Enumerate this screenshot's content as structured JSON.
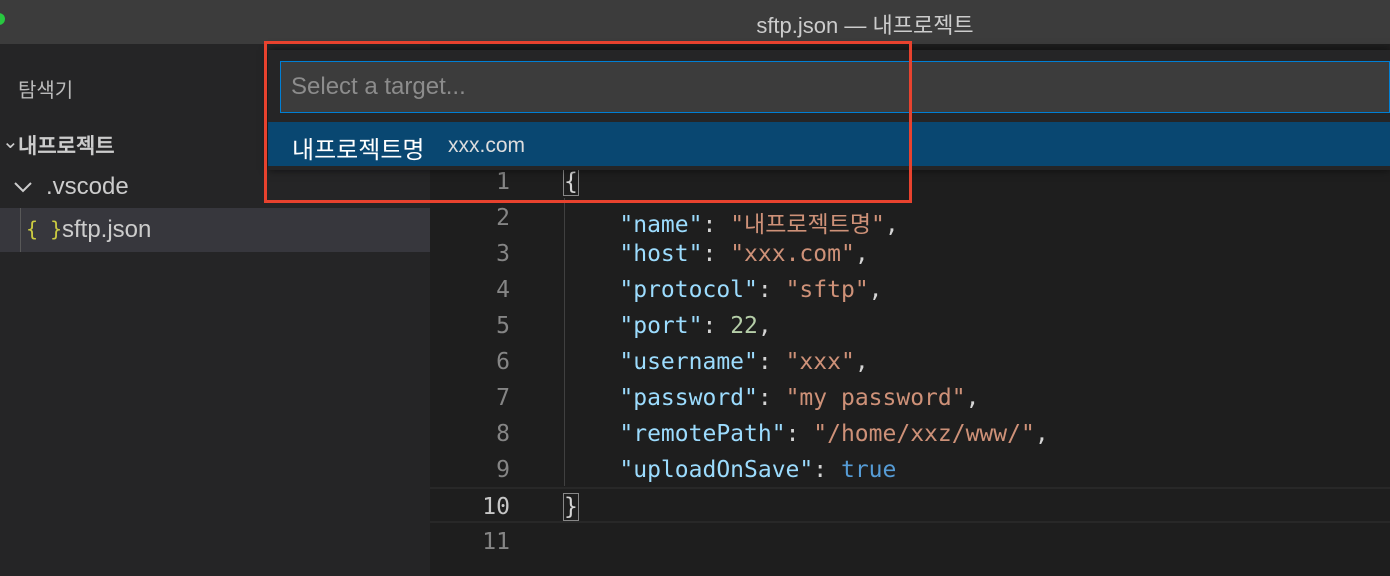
{
  "window": {
    "title": "sftp.json — 내프로젝트"
  },
  "sidebar": {
    "title": "탐색기",
    "project": "내프로젝트",
    "folder": ".vscode",
    "file": {
      "icon": "{ }",
      "name": "sftp.json"
    }
  },
  "quick_pick": {
    "placeholder": "Select a target...",
    "value": "",
    "items": [
      {
        "label": "내프로젝트명",
        "description": "xxx.com"
      }
    ]
  },
  "editor": {
    "current_line": 10,
    "lines": [
      {
        "num": "1"
      },
      {
        "num": "2",
        "key": "\"name\"",
        "value": "\"내프로젝트명\""
      },
      {
        "num": "3",
        "key": "\"host\"",
        "value": "\"xxx.com\""
      },
      {
        "num": "4",
        "key": "\"protocol\"",
        "value": "\"sftp\""
      },
      {
        "num": "5",
        "key": "\"port\"",
        "value": "22"
      },
      {
        "num": "6",
        "key": "\"username\"",
        "value": "\"xxx\""
      },
      {
        "num": "7",
        "key": "\"password\"",
        "value": "\"my password\""
      },
      {
        "num": "8",
        "key": "\"remotePath\"",
        "value": "\"/home/xxz/www/\""
      },
      {
        "num": "9",
        "key": "\"uploadOnSave\"",
        "value": "true"
      },
      {
        "num": "10"
      },
      {
        "num": "11"
      }
    ],
    "open_brace": "{",
    "close_brace": "}"
  },
  "colors": {
    "annotation_box": "#e8422e",
    "selection": "#094771",
    "json_key": "#9cdcfe",
    "json_string": "#ce9178",
    "json_number": "#b5cea8",
    "json_boolean": "#569cd6"
  }
}
